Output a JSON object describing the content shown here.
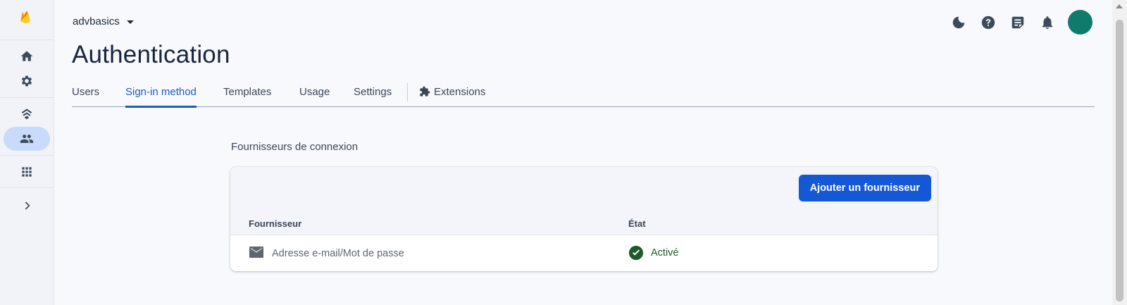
{
  "project": {
    "name": "advbasics"
  },
  "page": {
    "title": "Authentication"
  },
  "tabs": [
    {
      "label": "Users",
      "active": false
    },
    {
      "label": "Sign-in method",
      "active": true
    },
    {
      "label": "Templates",
      "active": false
    },
    {
      "label": "Usage",
      "active": false
    },
    {
      "label": "Settings",
      "active": false
    },
    {
      "label": "Extensions",
      "active": false,
      "icon": "extensions-icon"
    }
  ],
  "rail": {
    "icons": [
      "firebase-logo",
      "home-icon",
      "settings-icon",
      "build-icon",
      "authentication-icon",
      "all-products-icon",
      "expand-icon"
    ],
    "active": "authentication-icon"
  },
  "header_icons": [
    "dark-mode-icon",
    "help-icon",
    "release-notes-icon",
    "notifications-icon",
    "account-avatar"
  ],
  "providers": {
    "section_title": "Fournisseurs de connexion",
    "add_button": "Ajouter un fournisseur",
    "columns": {
      "provider": "Fournisseur",
      "state": "État"
    },
    "rows": [
      {
        "icon": "mail-icon",
        "name": "Adresse e-mail/Mot de passe",
        "state": "Activé",
        "state_icon": "check-circle-icon"
      }
    ]
  },
  "colors": {
    "accent": "#1558d6",
    "active_tab": "#1a5bc4",
    "rail_active": "#c8dbfb",
    "avatar": "#0f7b6c",
    "success": "#1d5c2a"
  }
}
